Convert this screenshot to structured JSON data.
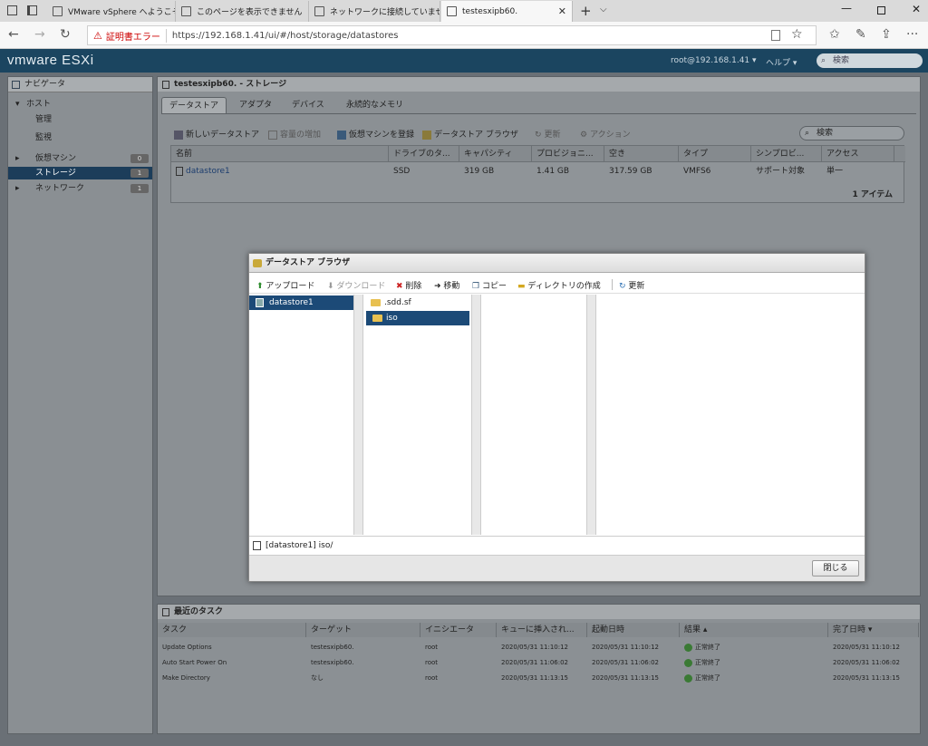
{
  "browser": {
    "tabs": [
      {
        "label": "VMware vSphere へようこそ"
      },
      {
        "label": "このページを表示できません"
      },
      {
        "label": "ネットワークに接続していません"
      },
      {
        "label": "testesxipb60."
      }
    ],
    "cert_error": "証明書エラー",
    "url": "https://192.168.1.41/ui/#/host/storage/datastores"
  },
  "esxi": {
    "logo": "vmware ESXi",
    "user": "root@192.168.1.41 ▾",
    "help": "ヘルプ ▾",
    "search_placeholder": "検索"
  },
  "navigator": {
    "title": "ナビゲータ",
    "items": [
      {
        "label": "ホスト",
        "count": ""
      },
      {
        "label": "管理",
        "count": ""
      },
      {
        "label": "監視",
        "count": ""
      },
      {
        "label": "仮想マシン",
        "count": "0"
      },
      {
        "label": "ストレージ",
        "count": "1"
      },
      {
        "label": "ネットワーク",
        "count": "1"
      }
    ]
  },
  "storage": {
    "title": "testesxipb60. - ストレージ",
    "tabs": [
      "データストア",
      "アダプタ",
      "デバイス",
      "永続的なメモリ"
    ],
    "toolbar": [
      "新しいデータストア",
      "容量の増加",
      "仮想マシンを登録",
      "データストア ブラウザ",
      "更新",
      "アクション"
    ],
    "search_placeholder": "検索",
    "columns": [
      "名前",
      "ドライブのタ...",
      "キャパシティ",
      "プロビジョニ...",
      "空き",
      "タイプ",
      "シンプロビ...",
      "アクセス"
    ],
    "rows": [
      [
        "datastore1",
        "SSD",
        "319 GB",
        "1.41 GB",
        "317.59 GB",
        "VMFS6",
        "サポート対象",
        "単一"
      ]
    ],
    "footer": "1 アイテム"
  },
  "tasks": {
    "title": "最近のタスク",
    "columns": [
      "タスク",
      "ターゲット",
      "イニシエータ",
      "キューに挿入され...",
      "起動日時",
      "結果 ▴",
      "完了日時 ▾"
    ],
    "rows": [
      [
        "Update Options",
        "testesxipb60.",
        "root",
        "2020/05/31 11:10:12",
        "2020/05/31 11:10:12",
        "正常終了",
        "2020/05/31 11:10:12"
      ],
      [
        "Auto Start Power On",
        "testesxipb60.",
        "root",
        "2020/05/31 11:06:02",
        "2020/05/31 11:06:02",
        "正常終了",
        "2020/05/31 11:06:02"
      ],
      [
        "Make Directory",
        "なし",
        "root",
        "2020/05/31 11:13:15",
        "2020/05/31 11:13:15",
        "正常終了",
        "2020/05/31 11:13:15"
      ]
    ]
  },
  "dialog": {
    "title": "データストア ブラウザ",
    "toolbar": [
      "アップロード",
      "ダウンロード",
      "削除",
      "移動",
      "コピー",
      "ディレクトリの作成",
      "更新"
    ],
    "datastores": [
      "datastore1"
    ],
    "folders": [
      ".sdd.sf",
      "iso"
    ],
    "path": "[datastore1] iso/",
    "close_label": "閉じる"
  }
}
